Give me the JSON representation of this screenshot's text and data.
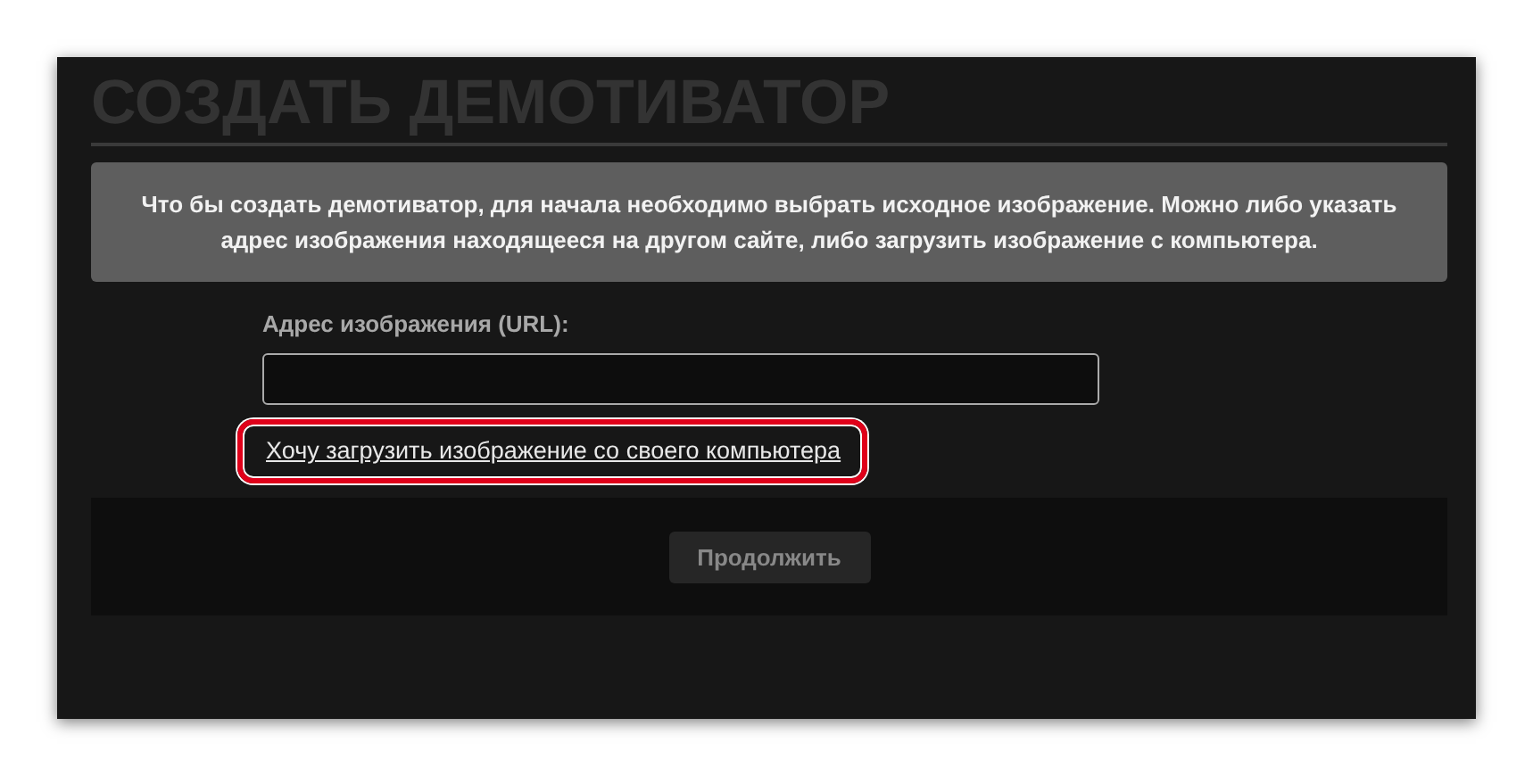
{
  "title": "СОЗДАТЬ ДЕМОТИВАТОР",
  "info": "Что бы создать демотиватор, для начала необходимо выбрать исходное изображение. Можно либо указать адрес изображения находящееся на другом сайте, либо загрузить изображение с компьютера.",
  "url_field": {
    "label": "Адрес изображения (URL):"
  },
  "upload_link": {
    "text": "Хочу загрузить изображение со своего компьютера",
    "highlighted": true
  },
  "buttons": [
    "Продолжить"
  ]
}
